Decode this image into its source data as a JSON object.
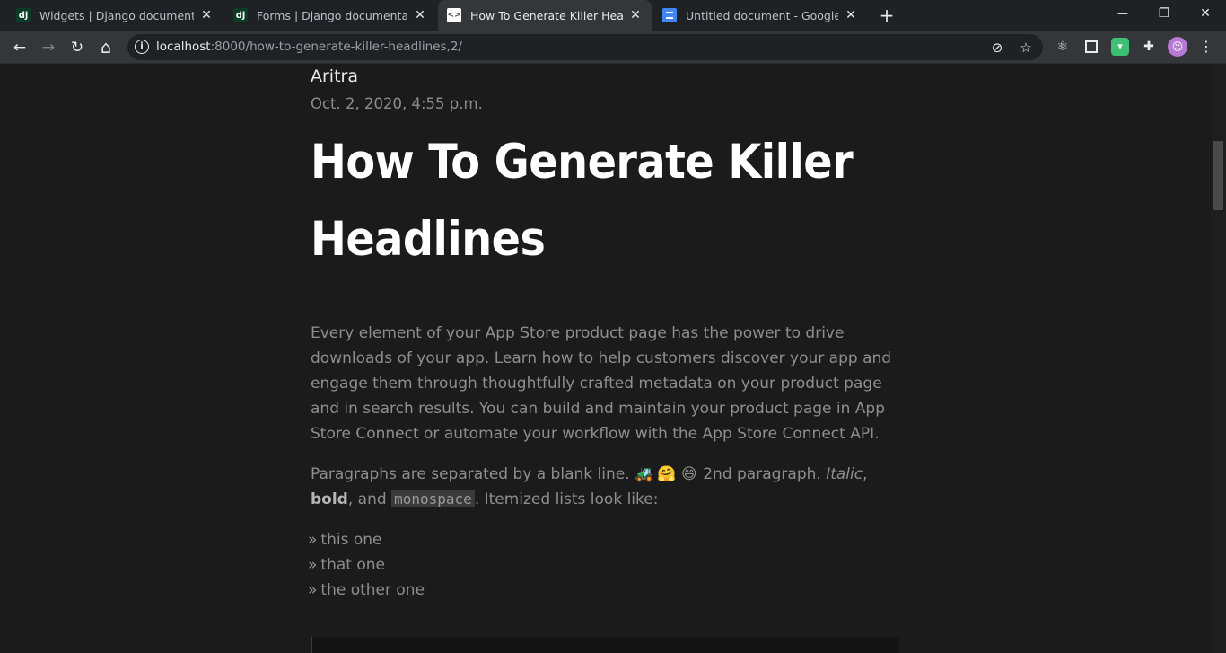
{
  "browser": {
    "tabs": [
      {
        "label": "Widgets | Django documentation",
        "favicon": "django-favicon",
        "active": false
      },
      {
        "label": "Forms | Django documentation |",
        "favicon": "django-favicon",
        "active": false
      },
      {
        "label": "How To Generate Killer Headlines",
        "favicon": "site-favicon",
        "active": true
      },
      {
        "label": "Untitled document - Google Docs",
        "favicon": "google-docs-favicon",
        "active": false
      }
    ],
    "address_host": "localhost",
    "address_path": ":8000/how-to-generate-killer-headlines,2/",
    "icons": {
      "back": "←",
      "forward": "→",
      "reload": "↻",
      "home": "⌂",
      "star": "☆",
      "menu": "⋮",
      "new_tab": "+",
      "minimize": "—",
      "restore": "❐",
      "close": "✕",
      "tab_close": "✕",
      "info": "i",
      "eye_off": "⊘",
      "react": "⚛",
      "puzzle": "✚",
      "avatar": "☺"
    }
  },
  "article": {
    "author": "Aritra",
    "date": "Oct. 2, 2020, 4:55 p.m.",
    "title_line1": "How To Generate Killer",
    "title_line2": "Headlines",
    "paragraph1": "Every element of your App Store product page has the power to drive downloads of your app. Learn how to help customers discover your app and engage them through thoughtfully crafted metadata on your product page and in search results. You can build and maintain your product page in App Store Connect or automate your workflow with the App Store Connect API.",
    "paragraph2_start": "Paragraphs are separated by a blank line.",
    "emojis": [
      "🚜",
      "🤗",
      "😄"
    ],
    "paragraph2_2nd": " 2nd paragraph. ",
    "italic": "Italic",
    "comma1": ",",
    "bold": "bold",
    "and_text": ", and ",
    "mono": "monospace",
    "paragraph2_end": ". Itemized lists look like:",
    "bullet": "»",
    "list": [
      "this one",
      "that one",
      "the other one"
    ]
  }
}
